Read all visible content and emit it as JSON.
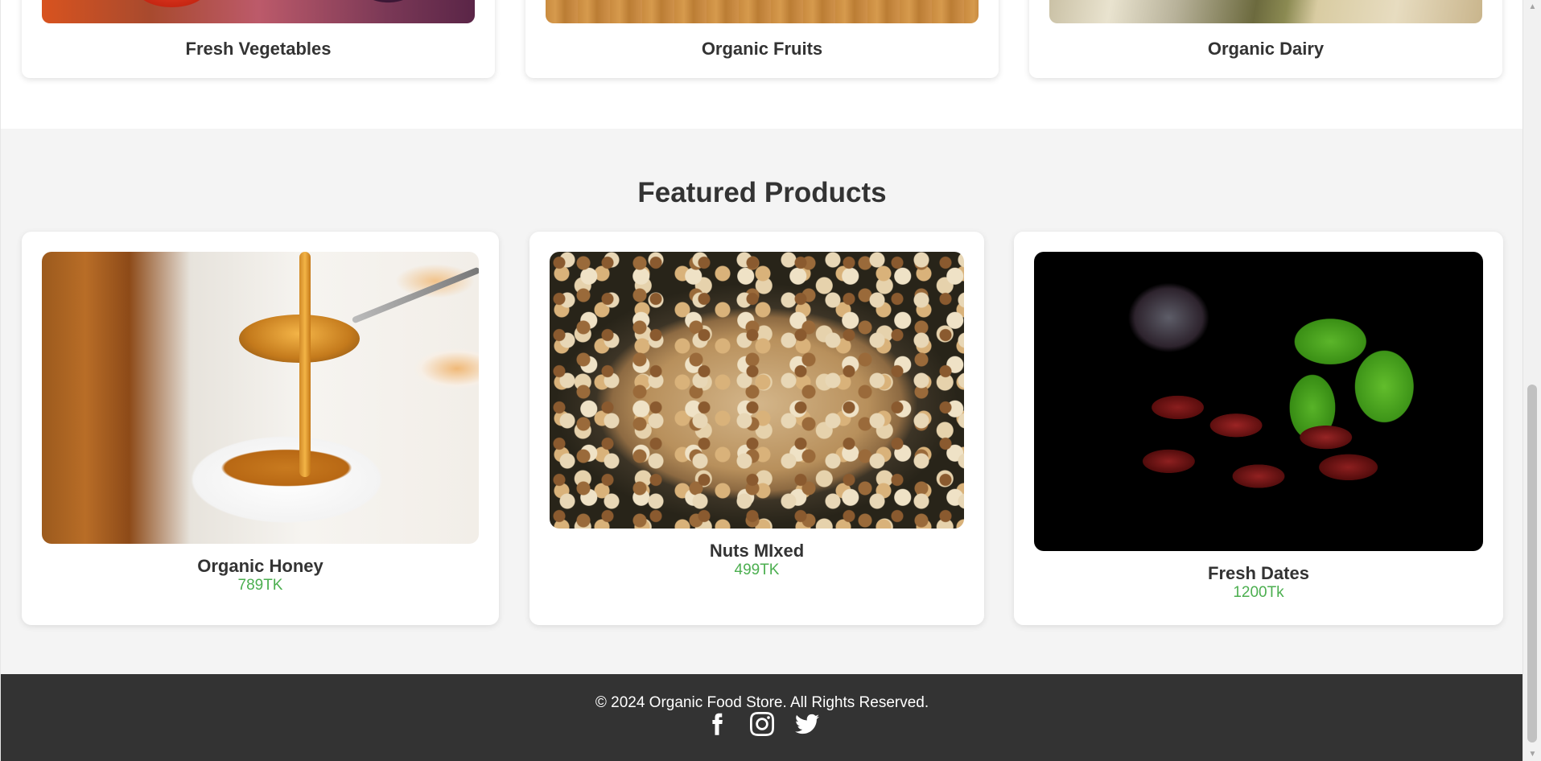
{
  "categories": [
    {
      "title": "Fresh Vegetables"
    },
    {
      "title": "Organic Fruits"
    },
    {
      "title": "Organic Dairy"
    }
  ],
  "featured": {
    "heading": "Featured Products",
    "products": [
      {
        "name": "Organic Honey",
        "price": "789TK"
      },
      {
        "name": "Nuts MIxed",
        "price": "499TK"
      },
      {
        "name": "Fresh Dates",
        "price": "1200Tk"
      }
    ]
  },
  "footer": {
    "copyright": "© 2024 Organic Food Store. All Rights Reserved.",
    "social": [
      "facebook-icon",
      "instagram-icon",
      "twitter-icon"
    ]
  },
  "colors": {
    "price": "#4caf50",
    "footer_bg": "#333333",
    "section_bg": "#f4f4f4"
  }
}
